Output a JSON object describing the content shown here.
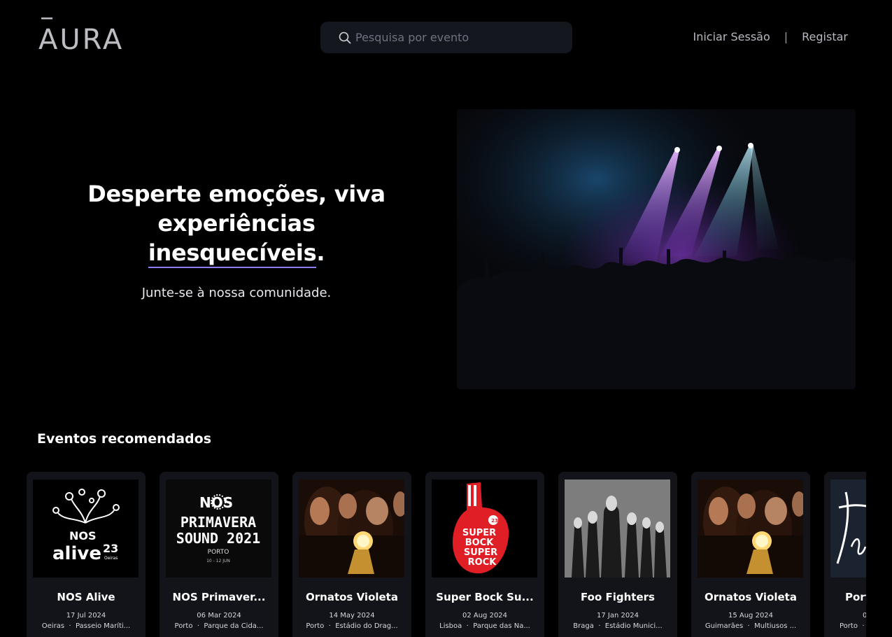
{
  "header": {
    "logo_text": "ĀURA",
    "search_placeholder": "Pesquisa por evento",
    "login_label": "Iniciar Sessão",
    "separator": "|",
    "register_label": "Registar"
  },
  "hero": {
    "title_line1": "Desperte emoções, viva",
    "title_line2": "experiências",
    "title_line3": "inesquecíveis",
    "title_dot": ".",
    "subtitle": "Junte-se à nossa comunidade."
  },
  "events": {
    "section_title": "Eventos recomendados",
    "items": [
      {
        "name": "NOS Alive",
        "date": "17 Jul 2024",
        "city": "Oeiras",
        "venue": "Passeio Maríti..."
      },
      {
        "name": "NOS Primaver...",
        "date": "06 Mar 2024",
        "city": "Porto",
        "venue": "Parque da Cida..."
      },
      {
        "name": "Ornatos Violeta",
        "date": "14 May 2024",
        "city": "Porto",
        "venue": "Estádio do Drag..."
      },
      {
        "name": "Super Bock Su...",
        "date": "02 Aug 2024",
        "city": "Lisboa",
        "venue": "Parque das Na..."
      },
      {
        "name": "Foo Fighters",
        "date": "17 Jan 2024",
        "city": "Braga",
        "venue": "Estádio Munici..."
      },
      {
        "name": "Ornatos Violeta",
        "date": "15 Aug 2024",
        "city": "Guimarães",
        "venue": "Multiusos ..."
      },
      {
        "name": "Port",
        "date": "0",
        "city": "Porto",
        "venue": ""
      }
    ],
    "loc_separator": "·",
    "poster_texts": {
      "alive_nos": "NOS",
      "alive_word": "alive",
      "alive_year": "23",
      "alive_place": "Oeiras",
      "primavera_nos": "NOS",
      "primavera_line1": "PRIMAVERA",
      "primavera_line2": "SOUND 2021",
      "primavera_city": "PORTO",
      "primavera_dates": "10 - 12 JUN",
      "sbsr_line1": "SUPER",
      "sbsr_line2": "BOCK",
      "sbsr_line3": "SUPER",
      "sbsr_line4": "ROCK",
      "sbsr_badge": "23"
    }
  },
  "colors": {
    "background": "#000000",
    "card": "#121419",
    "search_bg": "#15171e",
    "underline_accent": "#8b7cf0"
  }
}
